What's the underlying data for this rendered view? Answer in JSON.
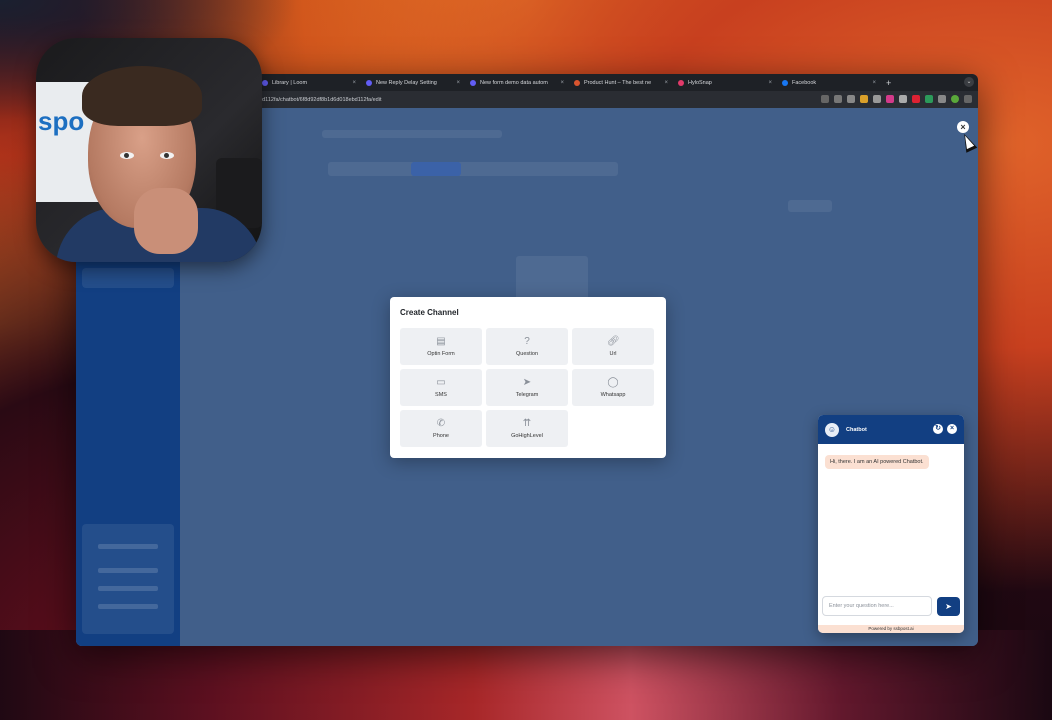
{
  "browser": {
    "tabs": [
      {
        "label": "Library | Loom",
        "color": "#625df5"
      },
      {
        "label": "New Reply Delay Setting",
        "color": "#625df5"
      },
      {
        "label": "New form demo data autom",
        "color": "#625df5"
      },
      {
        "label": "Product Hunt – The best ne",
        "color": "#da552f"
      },
      {
        "label": "HyloSnap",
        "color": "#e23a6a"
      },
      {
        "label": "Facebook",
        "color": "#1877f2"
      }
    ],
    "url": "ebd112fa/chatbot/6f8d92df8b1d6d018ebd112fa/edit"
  },
  "modal": {
    "title": "Create Channel",
    "channels": [
      {
        "label": "Optin Form",
        "icon": "form-icon"
      },
      {
        "label": "Question",
        "icon": "question-icon"
      },
      {
        "label": "Url",
        "icon": "link-icon"
      },
      {
        "label": "SMS",
        "icon": "sms-icon"
      },
      {
        "label": "Telegram",
        "icon": "telegram-icon"
      },
      {
        "label": "Whatsapp",
        "icon": "whatsapp-icon"
      },
      {
        "label": "Phone",
        "icon": "phone-icon"
      },
      {
        "label": "GoHighLevel",
        "icon": "gohighlevel-icon"
      }
    ]
  },
  "chatbot": {
    "title": "Chatbot",
    "greeting": "Hi, there. I am an AI powered Chatbot.",
    "input_placeholder": "Enter your question here...",
    "footer": "Powered by ssbpost.ai",
    "header_color": "#123f82",
    "bubble_color": "#fbe0d2"
  },
  "webcam": {
    "sign_text": "spo"
  }
}
